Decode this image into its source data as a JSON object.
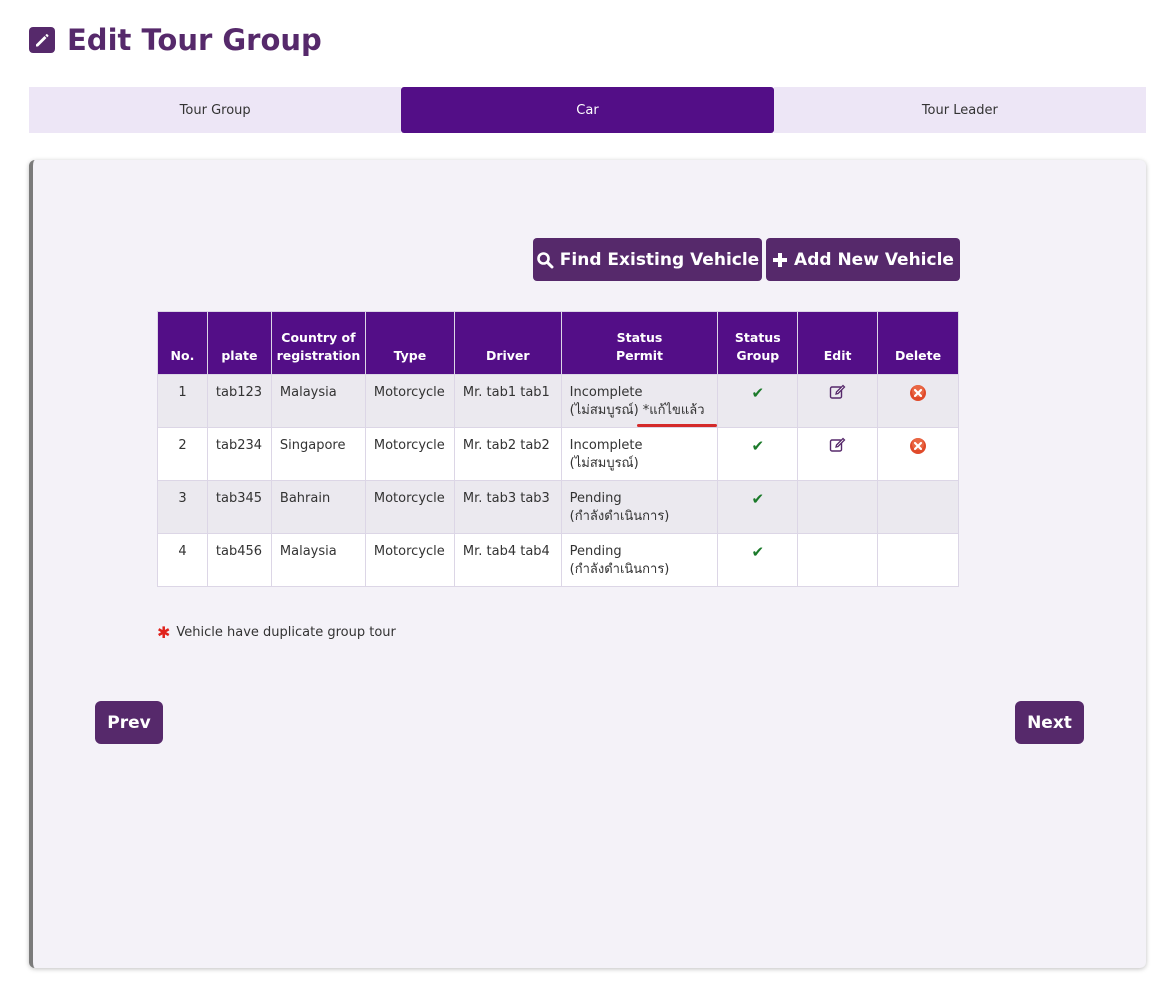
{
  "page": {
    "title": "Edit Tour Group",
    "title_icon": "edit-pencil-icon"
  },
  "tabs": [
    {
      "label": "Tour Group",
      "active": false
    },
    {
      "label": "Car",
      "active": true
    },
    {
      "label": "Tour Leader",
      "active": false
    }
  ],
  "actions": {
    "find_label": "Find Existing Vehicle",
    "find_icon": "search-icon",
    "add_label": "Add New Vehicle",
    "add_icon": "plus-icon"
  },
  "table": {
    "headers": {
      "no": "No.",
      "plate": "plate",
      "country": [
        "Country of",
        "registration"
      ],
      "type": "Type",
      "driver": "Driver",
      "status_permit": [
        "Status",
        "Permit"
      ],
      "status_group": [
        "Status",
        "Group"
      ],
      "edit": "Edit",
      "delete": "Delete"
    },
    "rows": [
      {
        "no": "1",
        "plate": "tab123",
        "country": "Malaysia",
        "type": "Motorcycle",
        "driver": "Mr. tab1 tab1",
        "status": "Incomplete",
        "status_th": "(ไม่สมบูรณ์)",
        "edited": "*แก้ไขแล้ว"
      },
      {
        "no": "2",
        "plate": "tab234",
        "country": "Singapore",
        "type": "Motorcycle",
        "driver": "Mr. tab2 tab2",
        "status": "Incomplete",
        "status_th": "(ไม่สมบูรณ์)"
      },
      {
        "no": "3",
        "plate": "tab345",
        "country": "Bahrain",
        "type": "Motorcycle",
        "driver": "Mr. tab3 tab3",
        "status": "Pending",
        "status_th": "(กำลังดำเนินการ)"
      },
      {
        "no": "4",
        "plate": "tab456",
        "country": "Malaysia",
        "type": "Motorcycle",
        "driver": "Mr. tab4 tab4",
        "status": "Pending",
        "status_th": "(กำลังดำเนินการ)"
      }
    ]
  },
  "note": {
    "text": "Vehicle have duplicate group tour"
  },
  "nav": {
    "prev_label": "Prev",
    "next_label": "Next"
  },
  "colors": {
    "brand": "#56296b",
    "tab_active": "#530e87",
    "tab_inactive": "#ede6f6",
    "check": "#1b7a2a",
    "delete": "#e04a2a",
    "required_star": "#e0231d"
  }
}
